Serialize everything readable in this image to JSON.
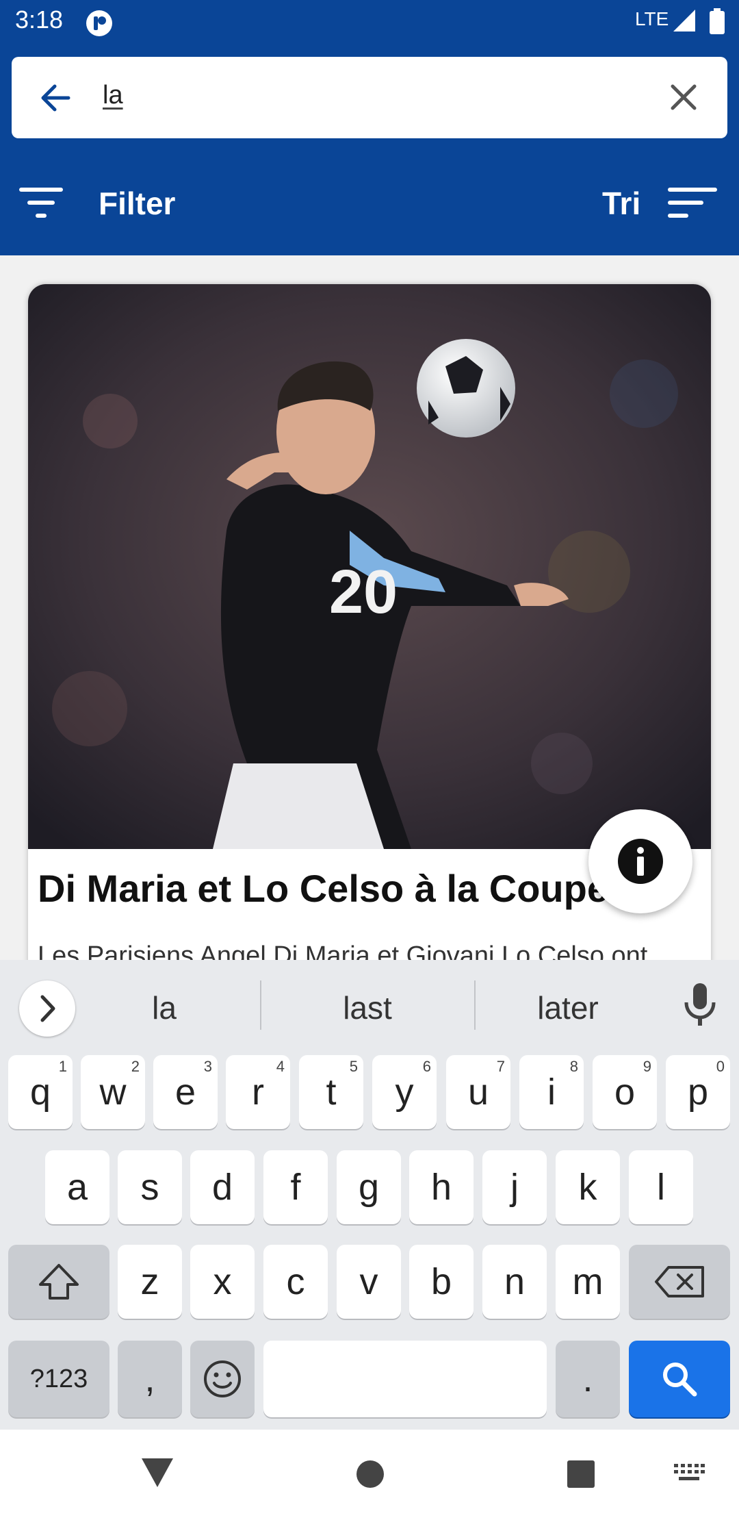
{
  "status_bar": {
    "time": "3:18",
    "network": "LTE"
  },
  "search": {
    "query": "la"
  },
  "toolbar": {
    "filter_label": "Filter",
    "sort_label": "Tri"
  },
  "article": {
    "title": "Di Maria et Lo Celso à la Coupe d...",
    "excerpt": "Les Parisiens Angel Di Maria et Giovani Lo Celso ont",
    "image_jersey_number": "20"
  },
  "keyboard": {
    "suggestions": [
      "la",
      "last",
      "later"
    ],
    "row1": [
      {
        "key": "q",
        "hint": "1"
      },
      {
        "key": "w",
        "hint": "2"
      },
      {
        "key": "e",
        "hint": "3"
      },
      {
        "key": "r",
        "hint": "4"
      },
      {
        "key": "t",
        "hint": "5"
      },
      {
        "key": "y",
        "hint": "6"
      },
      {
        "key": "u",
        "hint": "7"
      },
      {
        "key": "i",
        "hint": "8"
      },
      {
        "key": "o",
        "hint": "9"
      },
      {
        "key": "p",
        "hint": "0"
      }
    ],
    "row2": [
      "a",
      "s",
      "d",
      "f",
      "g",
      "h",
      "j",
      "k",
      "l"
    ],
    "row3": [
      "z",
      "x",
      "c",
      "v",
      "b",
      "n",
      "m"
    ],
    "symbols_label": "?123",
    "comma": ",",
    "period": "."
  },
  "colors": {
    "header_blue": "#0a4597",
    "accent_blue": "#1a73e8"
  }
}
